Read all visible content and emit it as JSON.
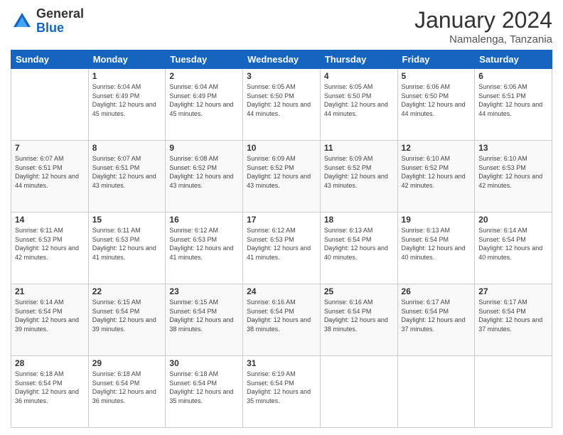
{
  "logo": {
    "general": "General",
    "blue": "Blue"
  },
  "title": "January 2024",
  "location": "Namalenga, Tanzania",
  "days_header": [
    "Sunday",
    "Monday",
    "Tuesday",
    "Wednesday",
    "Thursday",
    "Friday",
    "Saturday"
  ],
  "weeks": [
    [
      {
        "day": "",
        "sunrise": "",
        "sunset": "",
        "daylight": ""
      },
      {
        "day": "1",
        "sunrise": "6:04 AM",
        "sunset": "6:49 PM",
        "daylight": "12 hours and 45 minutes."
      },
      {
        "day": "2",
        "sunrise": "6:04 AM",
        "sunset": "6:49 PM",
        "daylight": "12 hours and 45 minutes."
      },
      {
        "day": "3",
        "sunrise": "6:05 AM",
        "sunset": "6:50 PM",
        "daylight": "12 hours and 44 minutes."
      },
      {
        "day": "4",
        "sunrise": "6:05 AM",
        "sunset": "6:50 PM",
        "daylight": "12 hours and 44 minutes."
      },
      {
        "day": "5",
        "sunrise": "6:06 AM",
        "sunset": "6:50 PM",
        "daylight": "12 hours and 44 minutes."
      },
      {
        "day": "6",
        "sunrise": "6:06 AM",
        "sunset": "6:51 PM",
        "daylight": "12 hours and 44 minutes."
      }
    ],
    [
      {
        "day": "7",
        "sunrise": "6:07 AM",
        "sunset": "6:51 PM",
        "daylight": "12 hours and 44 minutes."
      },
      {
        "day": "8",
        "sunrise": "6:07 AM",
        "sunset": "6:51 PM",
        "daylight": "12 hours and 43 minutes."
      },
      {
        "day": "9",
        "sunrise": "6:08 AM",
        "sunset": "6:52 PM",
        "daylight": "12 hours and 43 minutes."
      },
      {
        "day": "10",
        "sunrise": "6:09 AM",
        "sunset": "6:52 PM",
        "daylight": "12 hours and 43 minutes."
      },
      {
        "day": "11",
        "sunrise": "6:09 AM",
        "sunset": "6:52 PM",
        "daylight": "12 hours and 43 minutes."
      },
      {
        "day": "12",
        "sunrise": "6:10 AM",
        "sunset": "6:52 PM",
        "daylight": "12 hours and 42 minutes."
      },
      {
        "day": "13",
        "sunrise": "6:10 AM",
        "sunset": "6:53 PM",
        "daylight": "12 hours and 42 minutes."
      }
    ],
    [
      {
        "day": "14",
        "sunrise": "6:11 AM",
        "sunset": "6:53 PM",
        "daylight": "12 hours and 42 minutes."
      },
      {
        "day": "15",
        "sunrise": "6:11 AM",
        "sunset": "6:53 PM",
        "daylight": "12 hours and 41 minutes."
      },
      {
        "day": "16",
        "sunrise": "6:12 AM",
        "sunset": "6:53 PM",
        "daylight": "12 hours and 41 minutes."
      },
      {
        "day": "17",
        "sunrise": "6:12 AM",
        "sunset": "6:53 PM",
        "daylight": "12 hours and 41 minutes."
      },
      {
        "day": "18",
        "sunrise": "6:13 AM",
        "sunset": "6:54 PM",
        "daylight": "12 hours and 40 minutes."
      },
      {
        "day": "19",
        "sunrise": "6:13 AM",
        "sunset": "6:54 PM",
        "daylight": "12 hours and 40 minutes."
      },
      {
        "day": "20",
        "sunrise": "6:14 AM",
        "sunset": "6:54 PM",
        "daylight": "12 hours and 40 minutes."
      }
    ],
    [
      {
        "day": "21",
        "sunrise": "6:14 AM",
        "sunset": "6:54 PM",
        "daylight": "12 hours and 39 minutes."
      },
      {
        "day": "22",
        "sunrise": "6:15 AM",
        "sunset": "6:54 PM",
        "daylight": "12 hours and 39 minutes."
      },
      {
        "day": "23",
        "sunrise": "6:15 AM",
        "sunset": "6:54 PM",
        "daylight": "12 hours and 38 minutes."
      },
      {
        "day": "24",
        "sunrise": "6:16 AM",
        "sunset": "6:54 PM",
        "daylight": "12 hours and 38 minutes."
      },
      {
        "day": "25",
        "sunrise": "6:16 AM",
        "sunset": "6:54 PM",
        "daylight": "12 hours and 38 minutes."
      },
      {
        "day": "26",
        "sunrise": "6:17 AM",
        "sunset": "6:54 PM",
        "daylight": "12 hours and 37 minutes."
      },
      {
        "day": "27",
        "sunrise": "6:17 AM",
        "sunset": "6:54 PM",
        "daylight": "12 hours and 37 minutes."
      }
    ],
    [
      {
        "day": "28",
        "sunrise": "6:18 AM",
        "sunset": "6:54 PM",
        "daylight": "12 hours and 36 minutes."
      },
      {
        "day": "29",
        "sunrise": "6:18 AM",
        "sunset": "6:54 PM",
        "daylight": "12 hours and 36 minutes."
      },
      {
        "day": "30",
        "sunrise": "6:18 AM",
        "sunset": "6:54 PM",
        "daylight": "12 hours and 35 minutes."
      },
      {
        "day": "31",
        "sunrise": "6:19 AM",
        "sunset": "6:54 PM",
        "daylight": "12 hours and 35 minutes."
      },
      {
        "day": "",
        "sunrise": "",
        "sunset": "",
        "daylight": ""
      },
      {
        "day": "",
        "sunrise": "",
        "sunset": "",
        "daylight": ""
      },
      {
        "day": "",
        "sunrise": "",
        "sunset": "",
        "daylight": ""
      }
    ]
  ]
}
